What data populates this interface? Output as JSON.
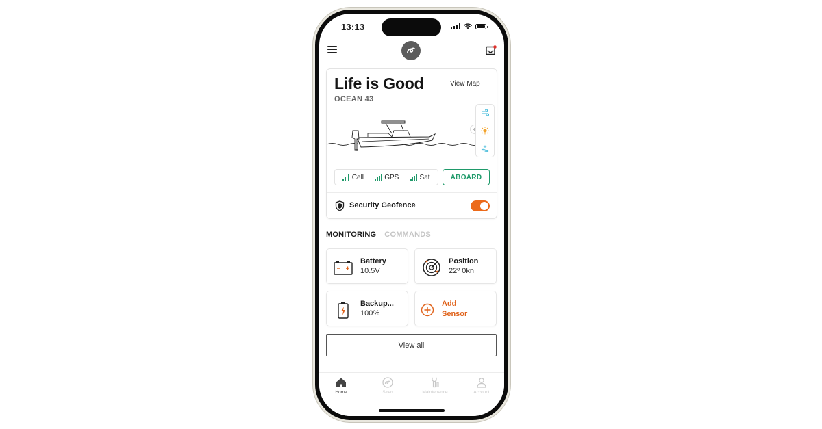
{
  "status_bar": {
    "time": "13:13"
  },
  "app_bar": {
    "menu_icon": "hamburger-menu-icon",
    "logo_icon": "siren-logo-icon",
    "inbox_icon": "inbox-notification-icon",
    "notification_color": "#e0312c"
  },
  "boat": {
    "name": "Life is Good",
    "model": "OCEAN 43",
    "view_map_label": "View Map",
    "weather_icons": [
      "wind-icon",
      "sun-icon",
      "tide-icon"
    ],
    "connectivity": [
      {
        "label": "Cell",
        "icon": "signal-bars-icon"
      },
      {
        "label": "GPS",
        "icon": "signal-bars-icon"
      },
      {
        "label": "Sat",
        "icon": "signal-bars-icon"
      }
    ],
    "aboard_label": "ABOARD",
    "geofence_label": "Security Geofence",
    "geofence_enabled": true
  },
  "tabs": [
    {
      "label": "MONITORING",
      "active": true
    },
    {
      "label": "COMMANDS",
      "active": false
    }
  ],
  "sensors": [
    {
      "title": "Battery",
      "value": "10.5V",
      "icon": "car-battery-icon"
    },
    {
      "title": "Position",
      "value": "22º 0kn",
      "icon": "radar-icon"
    },
    {
      "title": "Backup...",
      "value": "100%",
      "icon": "backup-battery-icon"
    },
    {
      "title": "Add Sensor",
      "value": "",
      "icon": "add-circle-icon"
    }
  ],
  "view_all_label": "View all",
  "bottom_nav": [
    {
      "label": "Home",
      "icon": "home-icon",
      "active": true
    },
    {
      "label": "Siren",
      "icon": "siren-icon",
      "active": false
    },
    {
      "label": "Maintenance",
      "icon": "wrench-icon",
      "active": false
    },
    {
      "label": "Account",
      "icon": "account-icon",
      "active": false
    }
  ],
  "colors": {
    "accent_orange": "#ec6a1a",
    "accent_green": "#1f9a6a",
    "weather_blue": "#3ab7d8"
  }
}
